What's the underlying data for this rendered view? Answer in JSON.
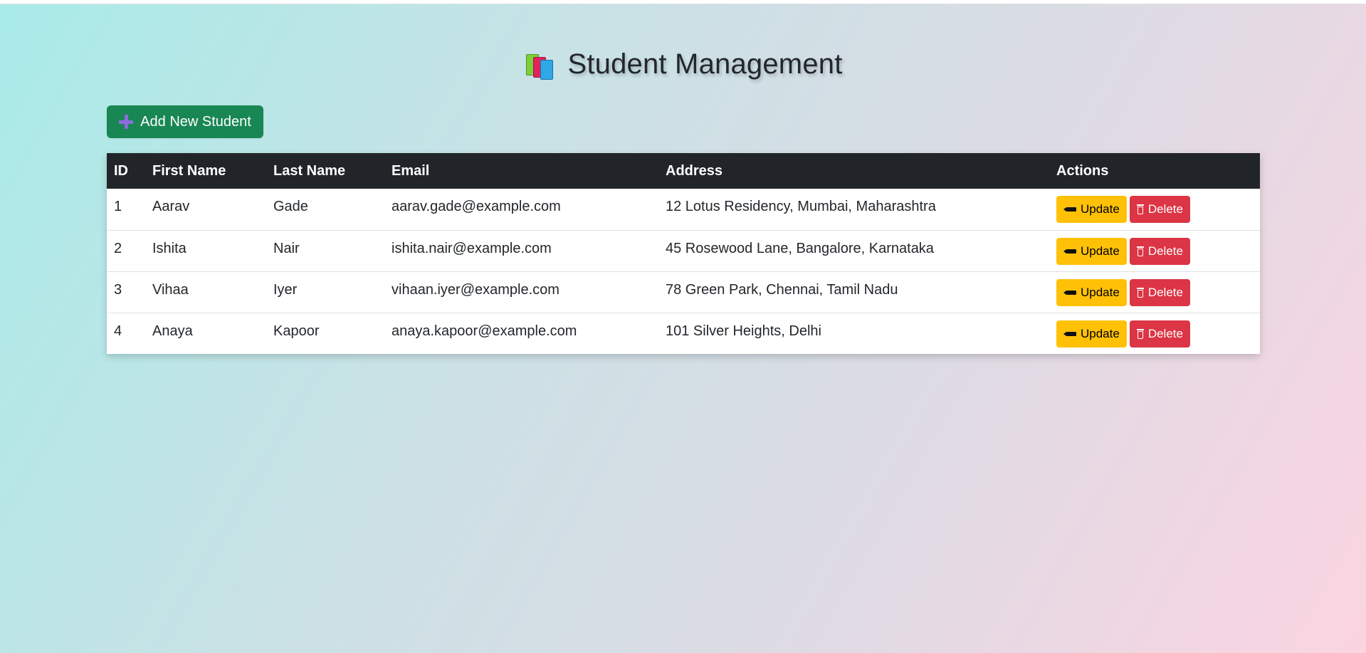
{
  "page": {
    "title": "Student Management",
    "title_icon": "books-icon"
  },
  "toolbar": {
    "add_label": "Add New Student",
    "add_icon": "plus-icon"
  },
  "table": {
    "headers": [
      "ID",
      "First Name",
      "Last Name",
      "Email",
      "Address",
      "Actions"
    ],
    "rows": [
      {
        "id": "1",
        "first_name": "Aarav",
        "last_name": "Gade",
        "email": "aarav.gade@example.com",
        "address": "12 Lotus Residency, Mumbai, Maharashtra"
      },
      {
        "id": "2",
        "first_name": "Ishita",
        "last_name": "Nair",
        "email": "ishita.nair@example.com",
        "address": "45 Rosewood Lane, Bangalore, Karnataka"
      },
      {
        "id": "3",
        "first_name": "Vihaa",
        "last_name": "Iyer",
        "email": "vihaan.iyer@example.com",
        "address": "78 Green Park, Chennai, Tamil Nadu"
      },
      {
        "id": "4",
        "first_name": "Anaya",
        "last_name": "Kapoor",
        "email": "anaya.kapoor@example.com",
        "address": "101 Silver Heights, Delhi"
      }
    ],
    "update_label": "Update",
    "delete_label": "Delete"
  },
  "colors": {
    "add_button": "#198754",
    "header_bg": "#212529",
    "update_button": "#ffc107",
    "delete_button": "#dc3545"
  }
}
